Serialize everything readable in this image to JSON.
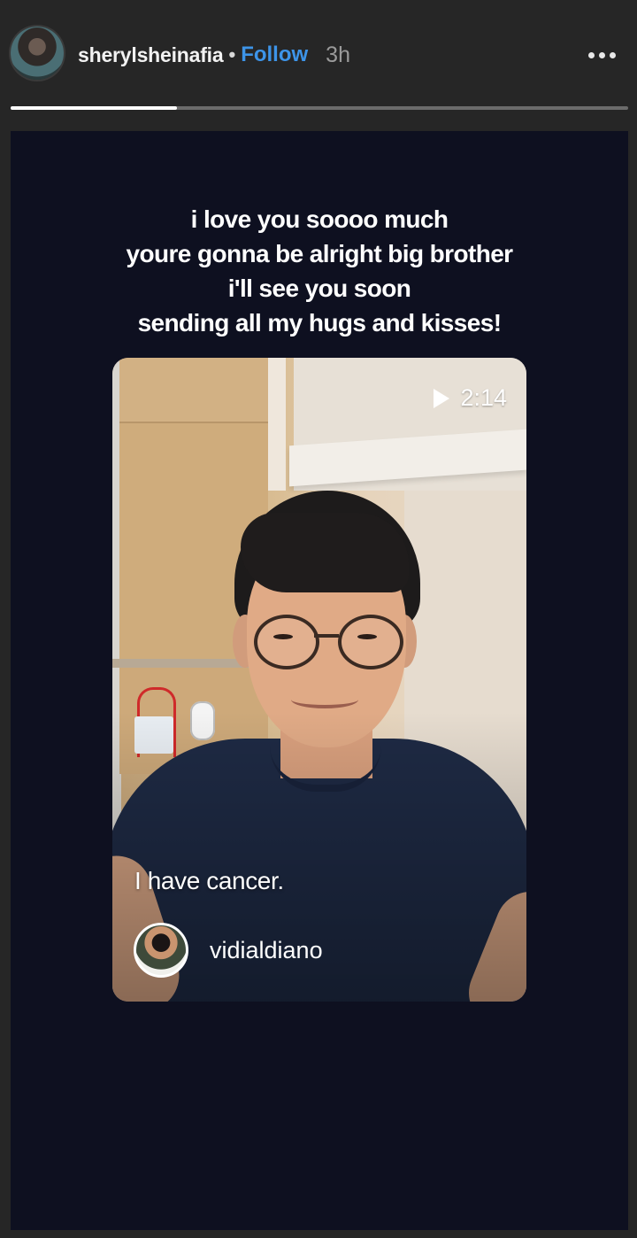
{
  "header": {
    "username": "sherylsheinafia",
    "separator": "•",
    "follow_label": "Follow",
    "time": "3h",
    "more_icon": "more-horizontal-icon"
  },
  "progress": {
    "current_segment_fraction": 0.27
  },
  "story": {
    "background_color": "#0e1020",
    "caption_lines": [
      "i love you soooo much",
      "youre gonna be alright big brother",
      "i'll see you soon",
      "sending all my hugs and kisses!"
    ],
    "shared_video": {
      "duration": "2:14",
      "play_icon": "play-icon",
      "subtitle": "I have cancer.",
      "author": "vidialdiano"
    }
  },
  "colors": {
    "follow": "#3d94e8",
    "header_bg": "#262626",
    "text": "#ffffff"
  }
}
